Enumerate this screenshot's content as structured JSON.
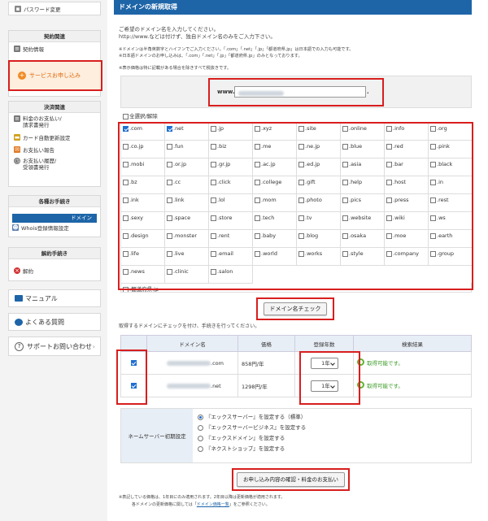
{
  "sidebar": {
    "password_change": "パスワード変更",
    "contract_header": "契約関連",
    "contract_info": "契約情報",
    "service_apply": "サービスお申し込み",
    "payment_header": "決済関連",
    "fee_payment": "料金のお支払い/\n請求書発行",
    "card_auto": "カード自動更新設定",
    "payment_report": "お支払い報告",
    "payment_history": "お支払い履歴/\n受領書発行",
    "procedures_header": "各種お手続き",
    "domain": "ドメイン",
    "whois": "Whois登録情報設定",
    "cancel_header": "解約手続き",
    "cancel": "解約",
    "manual": "マニュアル",
    "faq": "よくある質問",
    "support": "サポートお問い合わせ"
  },
  "main": {
    "title": "ドメインの新規取得",
    "intro1": "ご希望のドメイン名を入力してください。",
    "intro2": "http://www.などは付けず、独自ドメイン名のみをご入力下さい。",
    "note1": "※ドメインは半角英数字とハイフンでご入力ください。「.com」「.net」「.jp」「都道府県.jp」は日本語での入力も可能です。",
    "note2": "※日本語ドメインのお申し込みは、「.com」「.net」「.jp」「都道府県.jp」のみとなっております。",
    "note3": "※表示価格は特に記載がある場合を除きすべて税抜きです。",
    "www_prefix": "www.",
    "dot": ".",
    "select_all": "全選択/解除",
    "check_button": "ドメイン名チェック",
    "instruction": "取得するドメインにチェックを付け、手続きを行ってください。",
    "submit_button": "お申し込み内容の確認・料金のお支払い",
    "footnote1": "※表記している価格は、1年目にのみ適用されます。2年目以降は更新価格が適用されます。",
    "footnote2_pre": "各ドメインの更新価格に関しては「",
    "footnote2_link": "ドメイン価格一覧",
    "footnote2_post": "」をご参照ください。"
  },
  "tlds": [
    [
      ".com",
      true
    ],
    [
      ".net",
      true
    ],
    [
      ".jp",
      false
    ],
    [
      ".xyz",
      false
    ],
    [
      ".site",
      false
    ],
    [
      ".online",
      false
    ],
    [
      ".info",
      false
    ],
    [
      ".org",
      false
    ],
    [
      ".co.jp",
      false
    ],
    [
      ".fun",
      false
    ],
    [
      ".biz",
      false
    ],
    [
      ".me",
      false
    ],
    [
      ".ne.jp",
      false
    ],
    [
      ".blue",
      false
    ],
    [
      ".red",
      false
    ],
    [
      ".pink",
      false
    ],
    [
      ".mobi",
      false
    ],
    [
      ".or.jp",
      false
    ],
    [
      ".gr.jp",
      false
    ],
    [
      ".ac.jp",
      false
    ],
    [
      ".ed.jp",
      false
    ],
    [
      ".asia",
      false
    ],
    [
      ".bar",
      false
    ],
    [
      ".black",
      false
    ],
    [
      ".bz",
      false
    ],
    [
      ".cc",
      false
    ],
    [
      ".click",
      false
    ],
    [
      ".college",
      false
    ],
    [
      ".gift",
      false
    ],
    [
      ".help",
      false
    ],
    [
      ".host",
      false
    ],
    [
      ".in",
      false
    ],
    [
      ".ink",
      false
    ],
    [
      ".link",
      false
    ],
    [
      ".lol",
      false
    ],
    [
      ".mom",
      false
    ],
    [
      ".photo",
      false
    ],
    [
      ".pics",
      false
    ],
    [
      ".press",
      false
    ],
    [
      ".rest",
      false
    ],
    [
      ".sexy",
      false
    ],
    [
      ".space",
      false
    ],
    [
      ".store",
      false
    ],
    [
      ".tech",
      false
    ],
    [
      ".tv",
      false
    ],
    [
      ".website",
      false
    ],
    [
      ".wiki",
      false
    ],
    [
      ".ws",
      false
    ],
    [
      ".design",
      false
    ],
    [
      ".monster",
      false
    ],
    [
      ".rent",
      false
    ],
    [
      ".baby",
      false
    ],
    [
      ".blog",
      false
    ],
    [
      ".osaka",
      false
    ],
    [
      ".moe",
      false
    ],
    [
      ".earth",
      false
    ],
    [
      ".life",
      false
    ],
    [
      ".live",
      false
    ],
    [
      ".email",
      false
    ],
    [
      ".world",
      false
    ],
    [
      ".works",
      false
    ],
    [
      ".style",
      false
    ],
    [
      ".company",
      false
    ],
    [
      ".group",
      false
    ],
    [
      ".news",
      false
    ],
    [
      ".clinic",
      false
    ],
    [
      ".salon",
      false
    ]
  ],
  "prefecture": ".都道府県.jp",
  "results": {
    "headers": [
      "ドメイン名",
      "価格",
      "登録年数",
      "検索結果"
    ],
    "rows": [
      {
        "domain": ".com",
        "price": "858円/年",
        "years": "1年",
        "status": "取得可能です。"
      },
      {
        "domain": ".net",
        "price": "1298円/年",
        "years": "1年",
        "status": "取得可能です。"
      }
    ]
  },
  "nameserver": {
    "label": "ネームサーバー初期設定",
    "options": [
      {
        "label": "『エックスサーバー』を設定する（標準）",
        "selected": true
      },
      {
        "label": "『エックスサーバービジネス』を設定する",
        "selected": false
      },
      {
        "label": "『エックスドメイン』を設定する",
        "selected": false
      },
      {
        "label": "『ネクストショップ』を設定する",
        "selected": false
      }
    ]
  },
  "colors": {
    "header": "#1e65a8",
    "highlight": "#d81e1e",
    "success": "#3b9a26",
    "apply_bg": "#fdeede"
  }
}
